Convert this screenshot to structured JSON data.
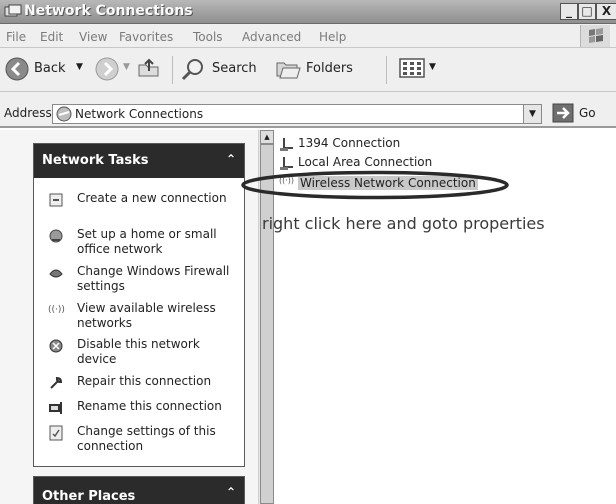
{
  "window": {
    "title": "Network Connections",
    "min_label": "_",
    "max_label": "□",
    "close_label": "X"
  },
  "menu": {
    "items": [
      "File",
      "Edit",
      "View",
      "Favorites",
      "Tools",
      "Advanced",
      "Help"
    ]
  },
  "toolbar": {
    "back_label": "Back",
    "search_label": "Search",
    "folders_label": "Folders"
  },
  "address": {
    "label": "Address",
    "value": "Network Connections",
    "go_label": "Go"
  },
  "tasks": {
    "title": "Network Tasks",
    "collapse_icon": "«",
    "items": [
      {
        "label": "Create a new connection",
        "icon": "new-connection-icon"
      },
      {
        "label": "Set up a home or small office network",
        "icon": "home-network-icon"
      },
      {
        "label": "Change Windows Firewall settings",
        "icon": "firewall-icon"
      },
      {
        "label": "View available wireless networks",
        "icon": "wireless-icon"
      },
      {
        "label": "Disable this network device",
        "icon": "disable-icon"
      },
      {
        "label": "Repair this connection",
        "icon": "repair-icon"
      },
      {
        "label": "Rename this connection",
        "icon": "rename-icon"
      },
      {
        "label": "Change settings of this connection",
        "icon": "settings-icon"
      }
    ]
  },
  "other_places": {
    "title": "Other Places",
    "collapse_icon": "«"
  },
  "connections": {
    "items": [
      {
        "label": "1394 Connection",
        "icon": "network-cable-icon"
      },
      {
        "label": "Local Area Connection",
        "icon": "network-cable-icon"
      },
      {
        "label": "Wireless Network Connection",
        "icon": "wireless-icon"
      }
    ]
  },
  "annotation": "right click here and goto properties",
  "colors": {
    "titlebar": "#9a9a9a",
    "panel_header": "#2b2b2b",
    "selection": "#c9c9c9"
  }
}
